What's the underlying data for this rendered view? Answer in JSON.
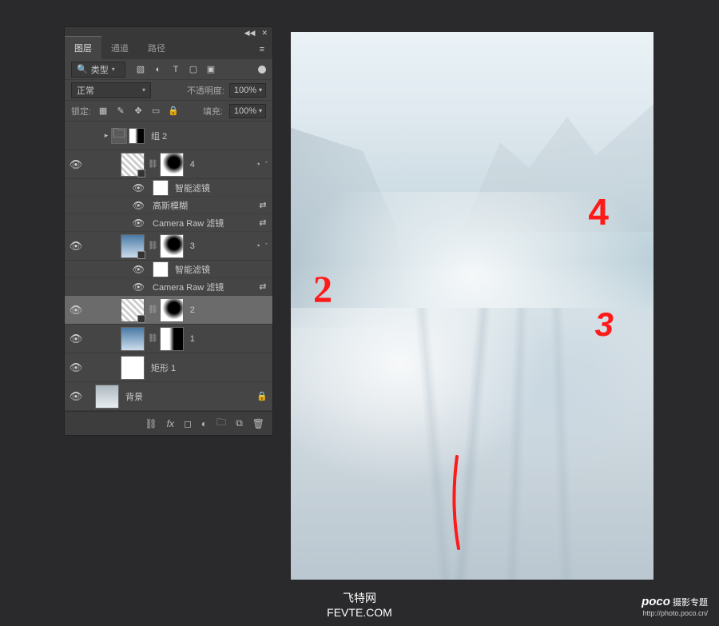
{
  "panel": {
    "tabs": {
      "layers": "图层",
      "channels": "通道",
      "paths": "路径"
    },
    "filter": {
      "kind": "类型"
    },
    "blend": {
      "mode": "正常",
      "opacity_label": "不透明度:",
      "opacity_value": "100%"
    },
    "lock": {
      "label": "锁定:",
      "fill_label": "填充:",
      "fill_value": "100%"
    }
  },
  "layers": {
    "group2": "组 2",
    "l4": "4",
    "smart_filters": "智能滤镜",
    "gaussian_blur": "高斯模糊",
    "camera_raw": "Camera Raw 滤镜",
    "l3": "3",
    "l2": "2",
    "l1": "1",
    "rect1": "矩形 1",
    "background": "背景"
  },
  "annotations": {
    "n1": "1",
    "n2": "2",
    "n3": "3",
    "n4": "4"
  },
  "footer": {
    "site_cn": "飞特网",
    "site_en": "FEVTE.COM",
    "poco_brand": "poco",
    "poco_label": "摄影专题",
    "poco_url": "http://photo.poco.cn/"
  }
}
